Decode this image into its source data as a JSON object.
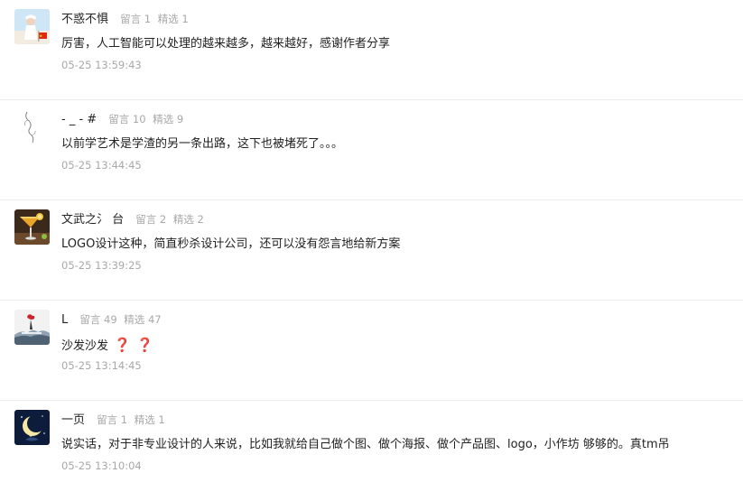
{
  "comments": [
    {
      "name": "不惑不惧",
      "msg_label": "留言 1",
      "pick_label": "精选 1",
      "text": "厉害，人工智能可以处理的越来越多，越来越好，感谢作者分享",
      "time": "05-25 13:59:43",
      "avatar": "beach-girl-flag-avatar"
    },
    {
      "name": "- _ - #",
      "msg_label": "留言 10",
      "pick_label": "精选 9",
      "text": "以前学艺术是学渣的另一条出路，这下也被堵死了。。。",
      "time": "05-25 13:44:45",
      "avatar": "sketch-line-avatar"
    },
    {
      "name": "文武之氵 台",
      "msg_label": "留言 2",
      "pick_label": "精选 2",
      "text": "LOGO设计这种，简直秒杀设计公司，还可以没有怨言地给新方案",
      "time": "05-25 13:39:25",
      "avatar": "cocktail-glass-avatar"
    },
    {
      "name": "L",
      "msg_label": "留言 49",
      "pick_label": "精选 47",
      "text": "沙发沙发",
      "text_suffix": [
        "❓",
        "❓"
      ],
      "time": "05-25 13:14:45",
      "avatar": "ink-painting-avatar"
    },
    {
      "name": "一页",
      "msg_label": "留言 1",
      "pick_label": "精选 1",
      "text": "说实话，对于非专业设计的人来说，比如我就给自己做个图、做个海报、做个产品图、logo，小作坊 够够的。真tm吊",
      "time": "05-25 13:10:04",
      "avatar": "moon-night-avatar"
    }
  ],
  "colors": {
    "meta_gray": "#a8a8a8",
    "divider": "#ececec",
    "question_red": "#d0232b"
  }
}
